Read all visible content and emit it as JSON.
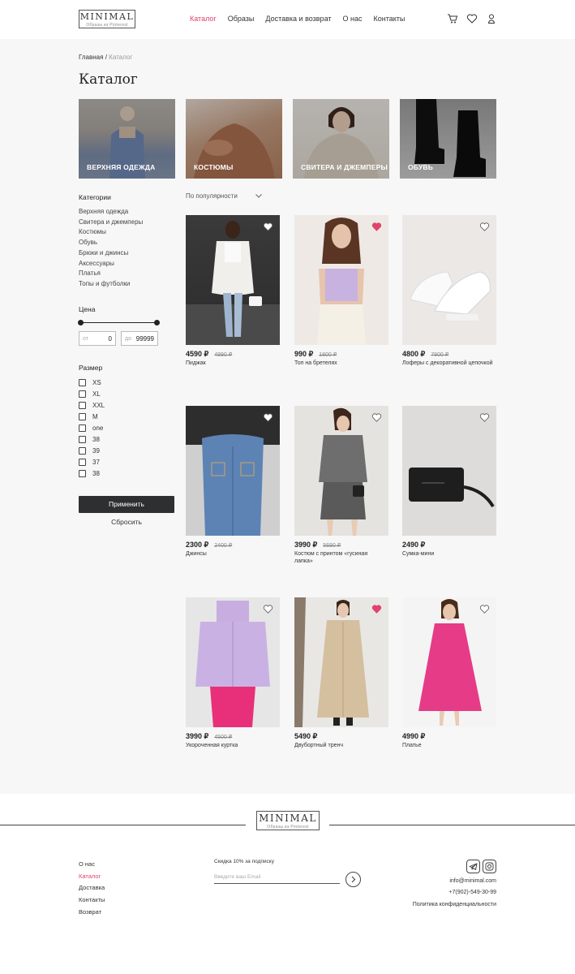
{
  "header": {
    "logo_main": "MINIMAL",
    "logo_sub": "Образы из Pinterest",
    "nav": [
      {
        "label": "Каталог",
        "active": true
      },
      {
        "label": "Образы",
        "active": false
      },
      {
        "label": "Доставка и возврат",
        "active": false
      },
      {
        "label": "О нас",
        "active": false
      },
      {
        "label": "Контакты",
        "active": false
      }
    ],
    "icons": [
      "cart-icon",
      "heart-icon",
      "user-icon"
    ]
  },
  "breadcrumb": {
    "home": "Главная",
    "separator": "/",
    "current": "Каталог"
  },
  "page_title": "Каталог",
  "categories_cards": [
    {
      "label": "ВЕРХНЯЯ ОДЕЖДА"
    },
    {
      "label": "КОСТЮМЫ"
    },
    {
      "label": "СВИТЕРА И ДЖЕМПЕРЫ"
    },
    {
      "label": "ОБУВЬ"
    }
  ],
  "sidebar": {
    "categories_title": "Категории",
    "categories": [
      "Верхняя одежда",
      "Свитера и джемперы",
      "Костюмы",
      "Обувь",
      "Брюки и джинсы",
      "Аксессуары",
      "Платья",
      "Топы и футболки"
    ],
    "price_title": "Цена",
    "price_from_label": "от",
    "price_from": "0",
    "price_to_label": "до",
    "price_to": "99999",
    "size_title": "Размер",
    "sizes": [
      "XS",
      "XL",
      "XXL",
      "M",
      "one",
      "38",
      "39",
      "37",
      "38"
    ],
    "apply": "Применить",
    "reset": "Сбросить"
  },
  "sort": {
    "label": "По популярности"
  },
  "products": [
    {
      "price": "4590 ₽",
      "old_price": "4990 ₽",
      "name": "Пиджак",
      "favorite": false
    },
    {
      "price": "990 ₽",
      "old_price": "1800 ₽",
      "name": "Топ на бретелях",
      "favorite": true
    },
    {
      "price": "4800 ₽",
      "old_price": "7800 ₽",
      "name": "Лоферы с декоративной цепочкой",
      "favorite": false
    },
    {
      "price": "2300 ₽",
      "old_price": "2400 ₽",
      "name": "Джинсы",
      "favorite": false
    },
    {
      "price": "3990 ₽",
      "old_price": "5690 ₽",
      "name": "Костюм с принтом «гусиная лапка»",
      "favorite": false
    },
    {
      "price": "2490 ₽",
      "old_price": "",
      "name": "Сумка-мини",
      "favorite": false
    },
    {
      "price": "3990 ₽",
      "old_price": "4500 ₽",
      "name": "Укороченная куртка",
      "favorite": false
    },
    {
      "price": "5490 ₽",
      "old_price": "",
      "name": "Двубортный тренч",
      "favorite": true
    },
    {
      "price": "4990 ₽",
      "old_price": "",
      "name": "Платье",
      "favorite": false
    }
  ],
  "footer": {
    "logo_main": "MINIMAL",
    "logo_sub": "Образы из Pinterest",
    "links": [
      {
        "label": "О нас",
        "active": false
      },
      {
        "label": "Каталог",
        "active": true
      },
      {
        "label": "Доставка",
        "active": false
      },
      {
        "label": "Контакты",
        "active": false
      },
      {
        "label": "Возврат",
        "active": false
      }
    ],
    "promo": "Скидка 10% за подписку",
    "email_placeholder": "Введите ваш Email",
    "email": "info@minimal.com",
    "phone": "+7(902)-549-30-99",
    "privacy": "Политика конфиденциальности",
    "social": [
      "telegram-icon",
      "instagram-icon"
    ]
  },
  "colors": {
    "accent": "#e0436d",
    "button_dark": "#2e2f31",
    "background": "#f7f7f7"
  }
}
